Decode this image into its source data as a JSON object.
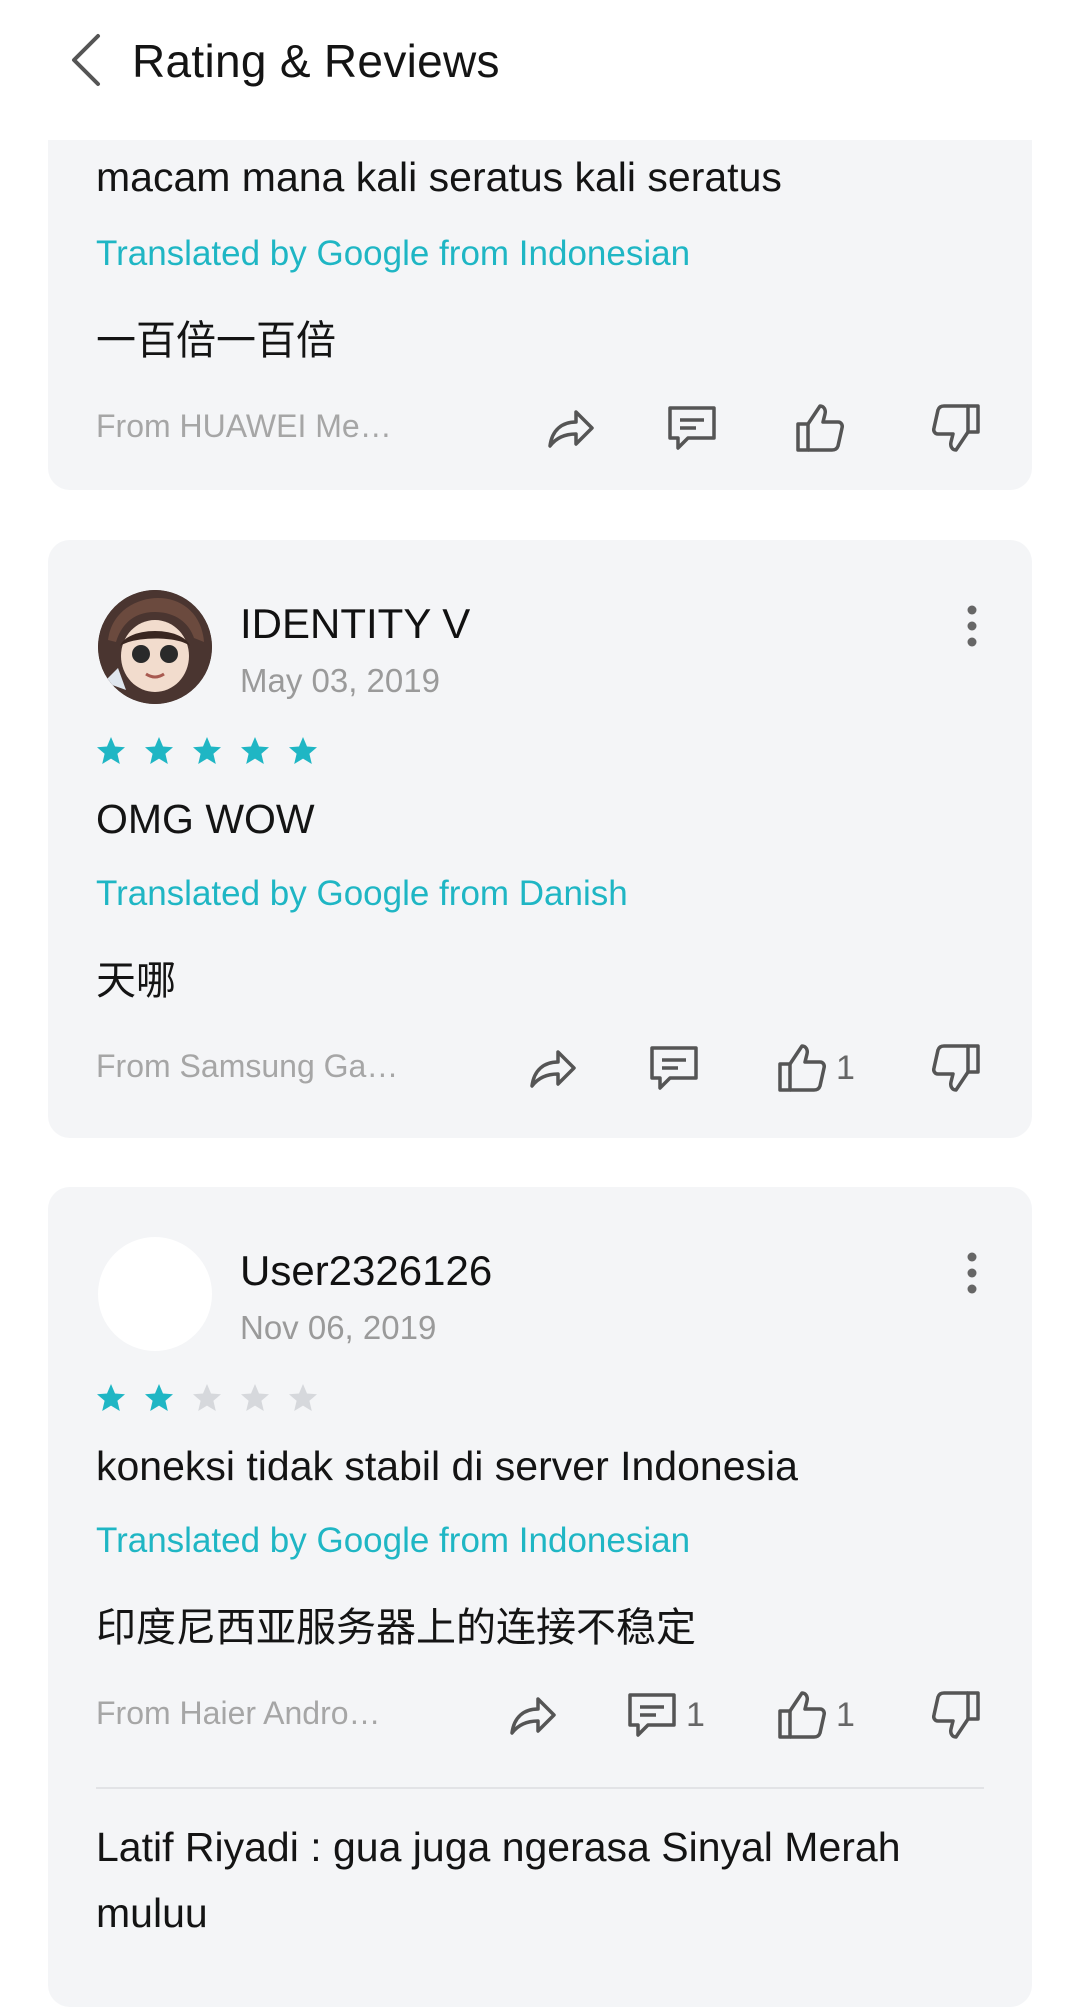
{
  "header": {
    "title": "Rating & Reviews",
    "back_icon": "chevron-left-icon"
  },
  "colors": {
    "accent": "#1fb6c4",
    "card_bg": "#f4f5f7",
    "star_empty": "#d6d8dc"
  },
  "reviews": [
    {
      "text": "macam mana kali seratus kali seratus",
      "translated_label": "Translated by Google from Indonesian",
      "translation": "一百倍一百倍",
      "source": "From HUAWEI Me…",
      "like_count": "",
      "comment_count": ""
    },
    {
      "username": "IDENTITY V",
      "date": "May 03, 2019",
      "rating": 5,
      "text": "OMG WOW",
      "translated_label": "Translated by Google from Danish",
      "translation": "天哪",
      "source": "From Samsung Ga…",
      "like_count": "1",
      "comment_count": ""
    },
    {
      "username": "User2326126",
      "date": "Nov 06, 2019",
      "rating": 2,
      "text": "koneksi tidak stabil di server Indonesia",
      "translated_label": "Translated by Google from Indonesian",
      "translation": "印度尼西亚服务器上的连接不稳定",
      "source": "From Haier Andro…",
      "like_count": "1",
      "comment_count": "1",
      "reply": "Latif Riyadi : gua juga ngerasa Sinyal Merah muluu"
    }
  ]
}
